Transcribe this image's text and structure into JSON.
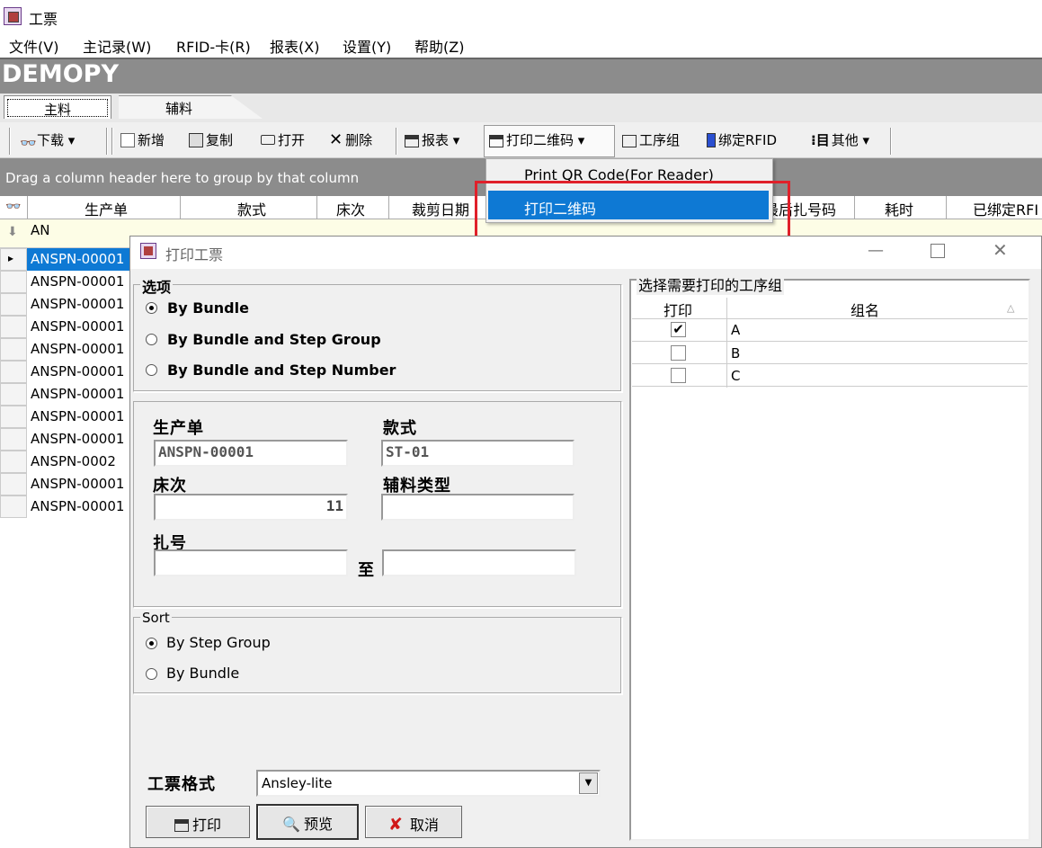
{
  "app": {
    "title": "工票"
  },
  "menu": [
    "文件(V)",
    "主记录(W)",
    "RFID-卡(R)",
    "报表(X)",
    "设置(Y)",
    "帮助(Z)"
  ],
  "brand": "DEMOPY",
  "tabs": [
    "主料",
    "辅料"
  ],
  "toolbar": {
    "download": "下载",
    "add": "新增",
    "copy": "复制",
    "open": "打开",
    "delete": "删除",
    "report": "报表",
    "print_qr": "打印二维码",
    "step_group": "工序组",
    "bind_rfid": "绑定RFID",
    "other": "其他"
  },
  "group_hint": "Drag a column header here to group by that column",
  "columns": [
    "生产单",
    "款式",
    "床次",
    "裁剪日期",
    "最后扎号码",
    "耗时",
    "已绑定RFI"
  ],
  "filter_value": "AN",
  "rows": [
    "ANSPN-00001",
    "ANSPN-00001",
    "ANSPN-00001",
    "ANSPN-00001",
    "ANSPN-00001",
    "ANSPN-00001",
    "ANSPN-00001",
    "ANSPN-00001",
    "ANSPN-00001",
    "ANSPN-0002",
    "ANSPN-00001",
    "ANSPN-00001"
  ],
  "dropdown": {
    "item1": "Print QR Code(For Reader)",
    "item2": "打印二维码"
  },
  "dialog": {
    "title": "打印工票",
    "options_label": "选项",
    "options": [
      "By Bundle",
      "By Bundle and Step Group",
      "By Bundle and Step Number"
    ],
    "prod_order_label": "生产单",
    "prod_order_value": "ANSPN-00001",
    "style_label": "款式",
    "style_value": "ST-01",
    "bed_label": "床次",
    "bed_value": "11",
    "aux_type_label": "辅料类型",
    "aux_type_value": "",
    "bundle_label": "扎号",
    "to_label": "至",
    "sort_label": "Sort",
    "sort_options": [
      "By Step Group",
      "By Bundle"
    ],
    "format_label": "工票格式",
    "format_value": "Ansley-lite",
    "print_btn": "打印",
    "preview_btn": "预览",
    "cancel_btn": "取消",
    "steps_label": "选择需要打印的工序组",
    "steps_col_print": "打印",
    "steps_col_name": "组名",
    "steps": [
      {
        "name": "A",
        "checked": true
      },
      {
        "name": "B",
        "checked": false
      },
      {
        "name": "C",
        "checked": false
      }
    ]
  }
}
